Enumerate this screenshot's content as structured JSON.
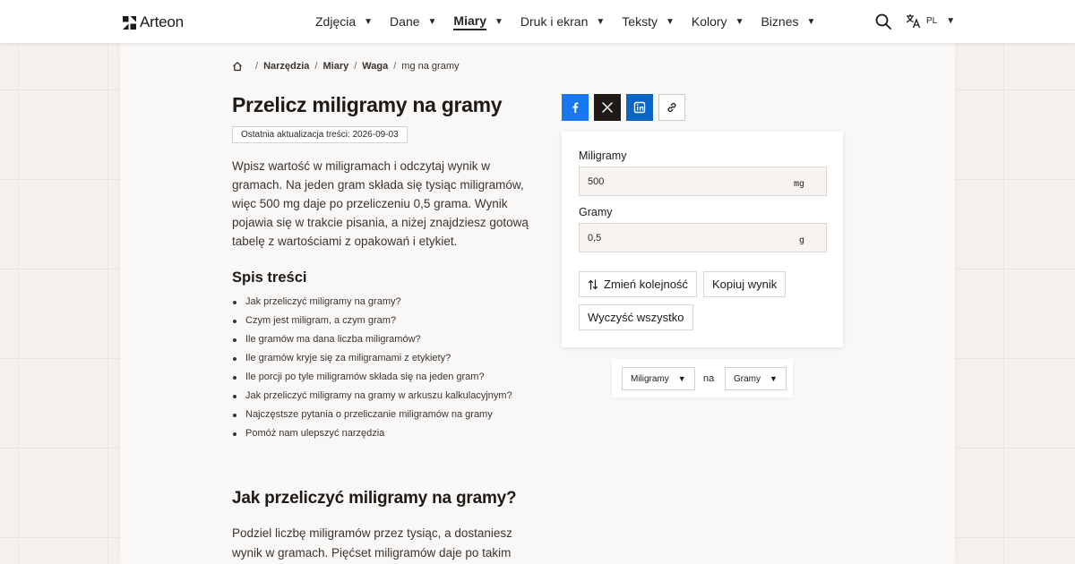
{
  "header": {
    "brand": "Arteon",
    "nav": [
      {
        "label": "Zdjęcia",
        "active": false
      },
      {
        "label": "Dane",
        "active": false
      },
      {
        "label": "Miary",
        "active": true
      },
      {
        "label": "Druk i ekran",
        "active": false
      },
      {
        "label": "Teksty",
        "active": false
      },
      {
        "label": "Kolory",
        "active": false
      },
      {
        "label": "Biznes",
        "active": false
      }
    ],
    "caret": "▼",
    "search_icon": "search-icon",
    "language": {
      "icon": "translate-icon",
      "code": "PL"
    }
  },
  "breadcrumb": {
    "home_icon": "home-icon",
    "separator": "/",
    "items": [
      "Narzędzia",
      "Miary",
      "Waga"
    ],
    "current": "mg na gramy"
  },
  "article": {
    "title": "Przelicz miligramy na gramy",
    "updated": "Ostatnia aktualizacja treści: 2026-09-03",
    "intro": "Wpisz wartość w miligramach i odczytaj wynik w gramach. Na jeden gram składa się tysiąc miligramów, więc 500 mg daje po przeliczeniu 0,5 grama. Wynik pojawia się w trakcie pisania, a niżej znajdziesz gotową tabelę z wartościami z opakowań i etykiet.",
    "toc_title": "Spis treści",
    "toc": [
      "Jak przeliczyć miligramy na gramy?",
      "Czym jest miligram, a czym gram?",
      "Ile gramów ma dana liczba miligramów?",
      "Ile gramów kryje się za miligramami z etykiety?",
      "Ile porcji po tyle miligramów składa się na jeden gram?",
      "Jak przeliczyć miligramy na gramy w arkuszu kalkulacyjnym?",
      "Najczęstsze pytania o przeliczanie miligramów na gramy",
      "Pomóż nam ulepszyć narzędzia"
    ],
    "section_title": "Jak przeliczyć miligramy na gramy?",
    "section_text": "Podziel liczbę miligramów przez tysiąc, a dostaniesz wynik w gramach. Pięćset miligramów daje po takim działaniu"
  },
  "share": {
    "facebook_icon": "facebook-icon",
    "x_icon": "x-icon",
    "linkedin_icon": "linkedin-icon",
    "link_icon": "link-icon"
  },
  "calculator": {
    "from": {
      "label": "Miligramy",
      "value": "500",
      "unit": "mg"
    },
    "to": {
      "label": "Gramy",
      "value": "0,5",
      "unit": "g"
    },
    "swap_label": "Zmień kolejność",
    "copy_label": "Kopiuj wynik",
    "clear_label": "Wyczyść wszystko"
  },
  "unit_picker": {
    "from": "Miligramy",
    "connector": "na",
    "to": "Gramy",
    "caret": "▼"
  },
  "colors": {
    "page_bg": "#f4f1ee",
    "panel_bg": "#faf8f6",
    "facebook": "#1877f2",
    "x": "#1d1a18",
    "linkedin": "#0a66c2"
  }
}
